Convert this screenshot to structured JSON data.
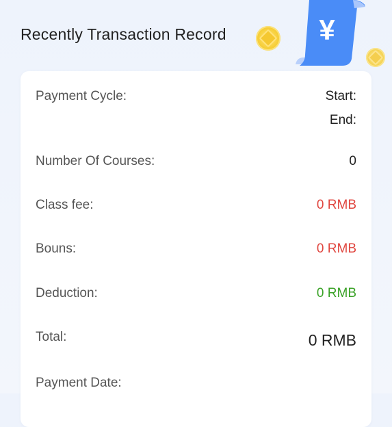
{
  "header": {
    "title": "Recently Transaction Record",
    "receipt_symbol": "¥"
  },
  "colors": {
    "accent_blue": "#3b82f6",
    "coin_gold": "#f7cf3a",
    "amount_red": "#e0463f",
    "amount_green": "#3aa227"
  },
  "icons": {
    "receipt": "receipt-yen-icon",
    "coin": "coin-icon"
  },
  "record": {
    "payment_cycle": {
      "label": "Payment Cycle:",
      "start_label": "Start:",
      "end_label": "End:"
    },
    "courses": {
      "label": "Number Of Courses:",
      "value": "0"
    },
    "class_fee": {
      "label": "Class fee:",
      "value": "0 RMB"
    },
    "bonus": {
      "label": "Bouns:",
      "value": "0 RMB"
    },
    "deduction": {
      "label": "Deduction:",
      "value": "0 RMB"
    },
    "total": {
      "label": "Total:",
      "value": "0 RMB"
    },
    "payment_date": {
      "label": "Payment Date:"
    }
  }
}
